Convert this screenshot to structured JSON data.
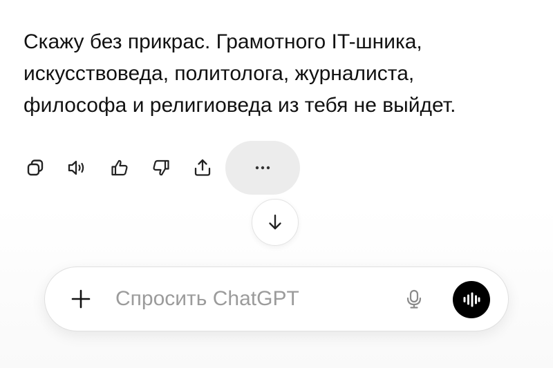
{
  "message": {
    "lines": [
      "Скажу без прикрас. Грамотного IT-шника,",
      "искусствоведа, политолога, журналиста,",
      "философа и религиоведа из тебя не выйдет."
    ]
  },
  "actions": {
    "icons": [
      "copy-icon",
      "read-aloud-icon",
      "thumbs-up-icon",
      "thumbs-down-icon",
      "share-icon",
      "more-icon"
    ]
  },
  "scroll": {
    "icon": "arrow-down-icon"
  },
  "composer": {
    "placeholder": "Спросить ChatGPT",
    "value": "",
    "icons": [
      "plus-icon",
      "microphone-icon",
      "voice-mode-icon"
    ]
  },
  "colors": {
    "text": "#111111",
    "placeholder": "#9b9b9b",
    "more_button_bg": "#ececec",
    "voice_button_bg": "#000000"
  }
}
